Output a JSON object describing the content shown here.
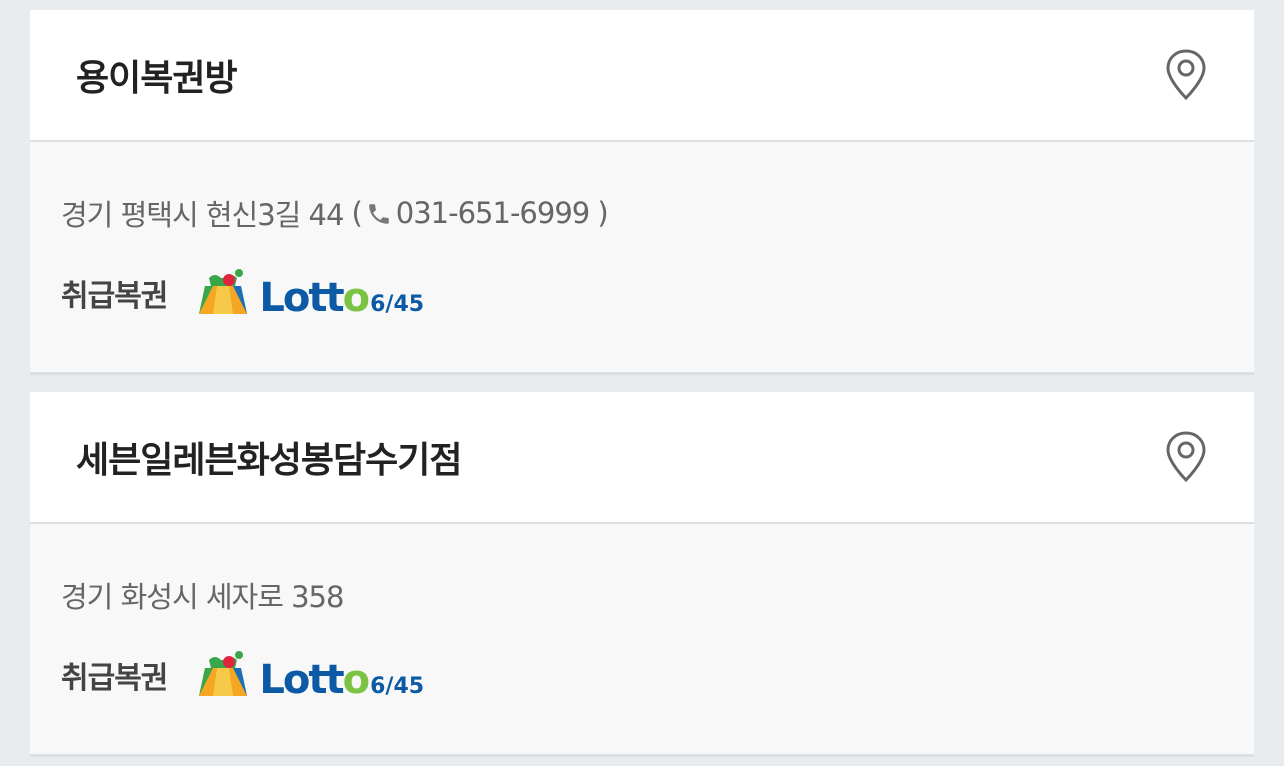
{
  "stores": [
    {
      "name": "용이복권방",
      "address": "경기 평택시 현신3길 44",
      "phone": "031-651-6999",
      "games_label": "취급복권",
      "game": {
        "word_main": "Lott",
        "word_o": "o",
        "suffix": "6/45"
      }
    },
    {
      "name": "세븐일레븐화성봉담수기점",
      "address": "경기 화성시 세자로 358",
      "phone": null,
      "games_label": "취급복권",
      "game": {
        "word_main": "Lott",
        "word_o": "o",
        "suffix": "6/45"
      }
    }
  ],
  "icons": {
    "map": "map-pin-icon",
    "phone": "phone-icon",
    "lotto": "lotto-bag-icon"
  },
  "colors": {
    "background": "#e9ecee",
    "card_head": "#ffffff",
    "card_body": "#f8f8f8",
    "lotto_blue": "#0c5aa6",
    "lotto_green": "#7cc243"
  }
}
